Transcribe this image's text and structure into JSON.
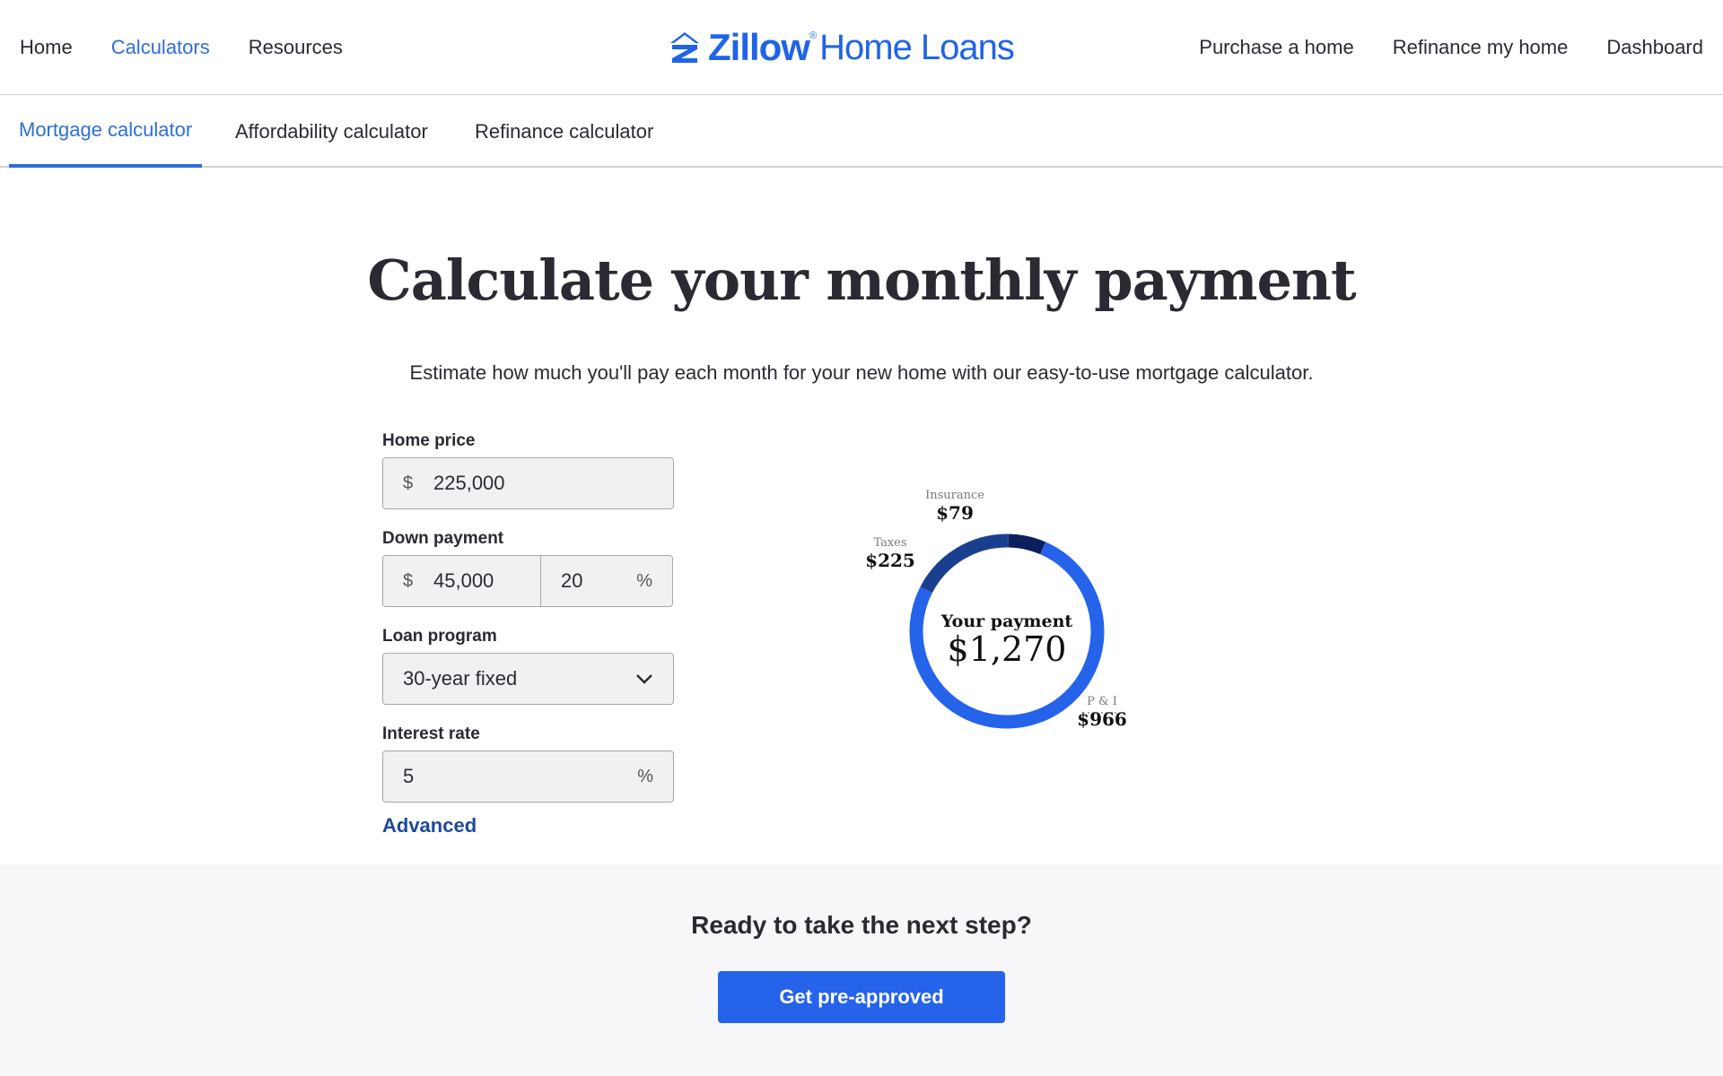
{
  "nav": {
    "left": [
      "Home",
      "Calculators",
      "Resources"
    ],
    "active": "Calculators",
    "right": [
      "Purchase a home",
      "Refinance my home",
      "Dashboard"
    ]
  },
  "logo": {
    "brand": "Zillow",
    "sub": "Home Loans",
    "color": "#1f64e6"
  },
  "tabs": [
    "Mortgage calculator",
    "Affordability calculator",
    "Refinance calculator"
  ],
  "active_tab": "Mortgage calculator",
  "heading": "Calculate your monthly payment",
  "subheading": "Estimate how much you'll pay each month for your new home with our easy-to-use mortgage calculator.",
  "form": {
    "home_price": {
      "label": "Home price",
      "prefix": "$",
      "value": "225,000"
    },
    "down_payment": {
      "label": "Down payment",
      "prefix": "$",
      "value": "45,000",
      "percent": "20",
      "suffix": "%"
    },
    "loan_program": {
      "label": "Loan program",
      "value": "30-year fixed"
    },
    "interest_rate": {
      "label": "Interest rate",
      "value": "5",
      "suffix": "%"
    },
    "advanced": "Advanced"
  },
  "payment": {
    "label": "Your payment",
    "total": "$1,270",
    "breakdown": [
      {
        "name": "P & I",
        "display": "$966",
        "value": 966,
        "color": "#2563eb"
      },
      {
        "name": "Taxes",
        "display": "$225",
        "value": 225,
        "color": "#1b3f8f"
      },
      {
        "name": "Insurance",
        "display": "$79",
        "value": 79,
        "color": "#0a1f5c"
      }
    ]
  },
  "cta": {
    "heading": "Ready to take the next step?",
    "button": "Get pre-approved",
    "color": "#2563eb"
  }
}
